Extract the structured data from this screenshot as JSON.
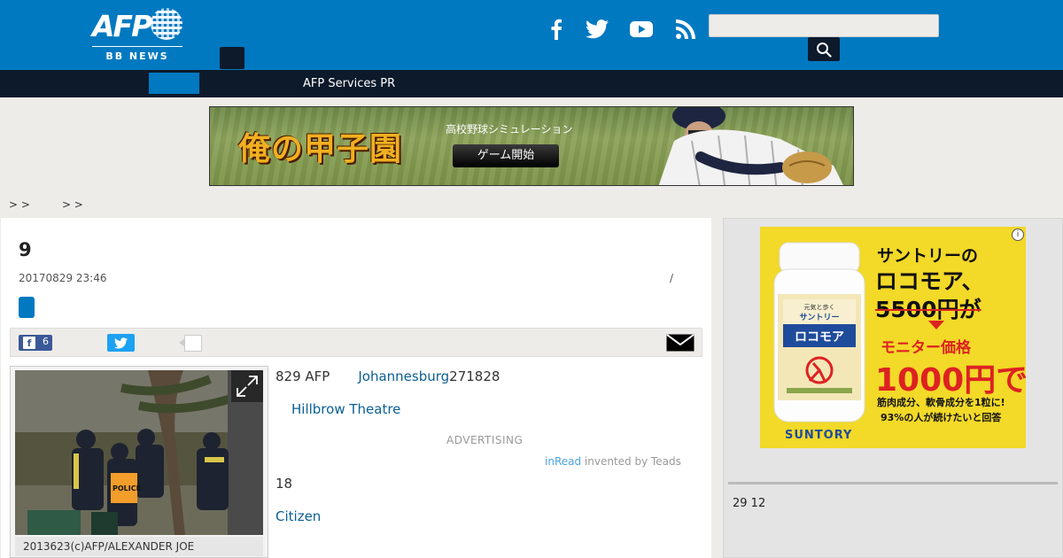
{
  "header": {
    "logo_text": "AFP",
    "logo_sub": "BB NEWS",
    "social": [
      "facebook-icon",
      "twitter-icon",
      "youtube-icon",
      "rss-icon"
    ],
    "search_placeholder": "",
    "colors": {
      "brand": "#0079c1",
      "dark": "#0c1a2b"
    }
  },
  "nav": {
    "link": "AFP Services PR"
  },
  "banner": {
    "title": "俺の甲子園",
    "subtitle": "高校野球シミュレーション",
    "button": "ゲーム開始"
  },
  "breadcrumb": [
    "> >",
    "> >"
  ],
  "article": {
    "title": "9",
    "date": "20170829 23:46",
    "slash": "/",
    "share": {
      "facebook_count": "6"
    },
    "photo_caption": "2013623(c)AFP/ALEXANDER JOE",
    "p1_a": "829 AFP",
    "p1_link": "Johannesburg",
    "p1_b": "271828",
    "p2_link": "Hillbrow Theatre",
    "advertising": "ADVERTISING",
    "inread_brand": "inRead",
    "inread_text": " invented by Teads",
    "p3": "18",
    "p4_link": "Citizen"
  },
  "sidebar": {
    "ad": {
      "line1": "サントリーの",
      "line2": "ロコモア、",
      "line3": "5500円が",
      "line4": "モニター価格",
      "line5": "1000円で!",
      "line6": "筋肉成分、軟骨成分を1粒に!",
      "line7": "93%の人が続けたいと回答",
      "brand": "SUNTORY",
      "bottle_label": "ロコモア",
      "bottle_brand": "サントリー"
    },
    "text": "29 12"
  }
}
